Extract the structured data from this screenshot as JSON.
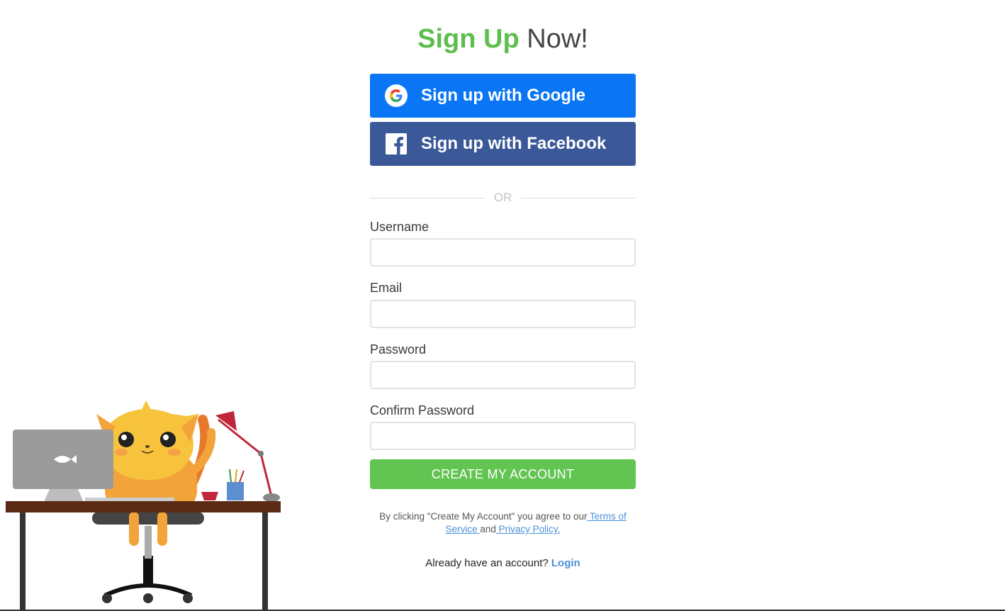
{
  "title": {
    "bold": "Sign Up",
    "light": "Now!"
  },
  "social": {
    "google_label": "Sign up with Google",
    "facebook_label": "Sign up with Facebook"
  },
  "divider_text": "OR",
  "fields": {
    "username_label": "Username",
    "email_label": "Email",
    "password_label": "Password",
    "confirm_password_label": "Confirm Password"
  },
  "create_button_label": "CREATE MY ACCOUNT",
  "terms": {
    "prefix": "By clicking \"Create My Account\" you agree to our",
    "terms_link": " Terms of Service ",
    "and": "and",
    "privacy_link": " Privacy Policy."
  },
  "login": {
    "prompt": "Already have an account? ",
    "link": "Login"
  },
  "colors": {
    "accent_green": "#5fbd4f",
    "google_blue": "#0a76f5",
    "facebook_blue": "#3b5998",
    "link_blue": "#4a90d9"
  }
}
